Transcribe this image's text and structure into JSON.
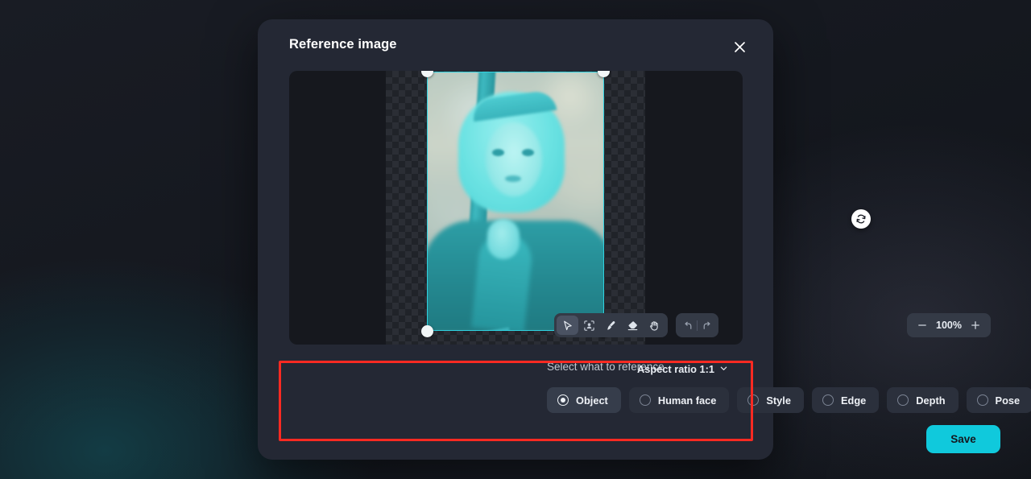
{
  "modal": {
    "title": "Reference image",
    "close_icon": "close-icon"
  },
  "canvas": {
    "refresh_icon": "refresh-icon",
    "photo_alt": "cosplay portrait with sword, cyan mask overlay"
  },
  "toolbar": {
    "tools": [
      {
        "name": "select-tool",
        "icon": "cursor-icon",
        "active": true
      },
      {
        "name": "face-select-tool",
        "icon": "face-frame-icon",
        "active": false
      },
      {
        "name": "brush-tool",
        "icon": "brush-icon",
        "active": false
      },
      {
        "name": "eraser-tool",
        "icon": "eraser-icon",
        "active": false
      },
      {
        "name": "pan-tool",
        "icon": "hand-icon",
        "active": false
      }
    ],
    "undo_icon": "undo-icon",
    "redo_icon": "redo-icon"
  },
  "zoom": {
    "minus_label": "−",
    "value": "100%",
    "plus_label": "+"
  },
  "select_section": {
    "label": "Select what to reference",
    "aspect_ratio": "Aspect ratio 1:1",
    "aspect_chevron_icon": "chevron-down-icon",
    "options": [
      {
        "label": "Object",
        "selected": true
      },
      {
        "label": "Human face",
        "selected": false
      },
      {
        "label": "Style",
        "selected": false
      },
      {
        "label": "Edge",
        "selected": false
      },
      {
        "label": "Depth",
        "selected": false
      },
      {
        "label": "Pose",
        "selected": false
      }
    ]
  },
  "footer": {
    "save_label": "Save"
  },
  "colors": {
    "accent": "#10c9dc",
    "annotation": "#fb2a22",
    "mask": "#2fd2e0",
    "modal_bg": "#242834",
    "page_bg": "#15181f"
  }
}
